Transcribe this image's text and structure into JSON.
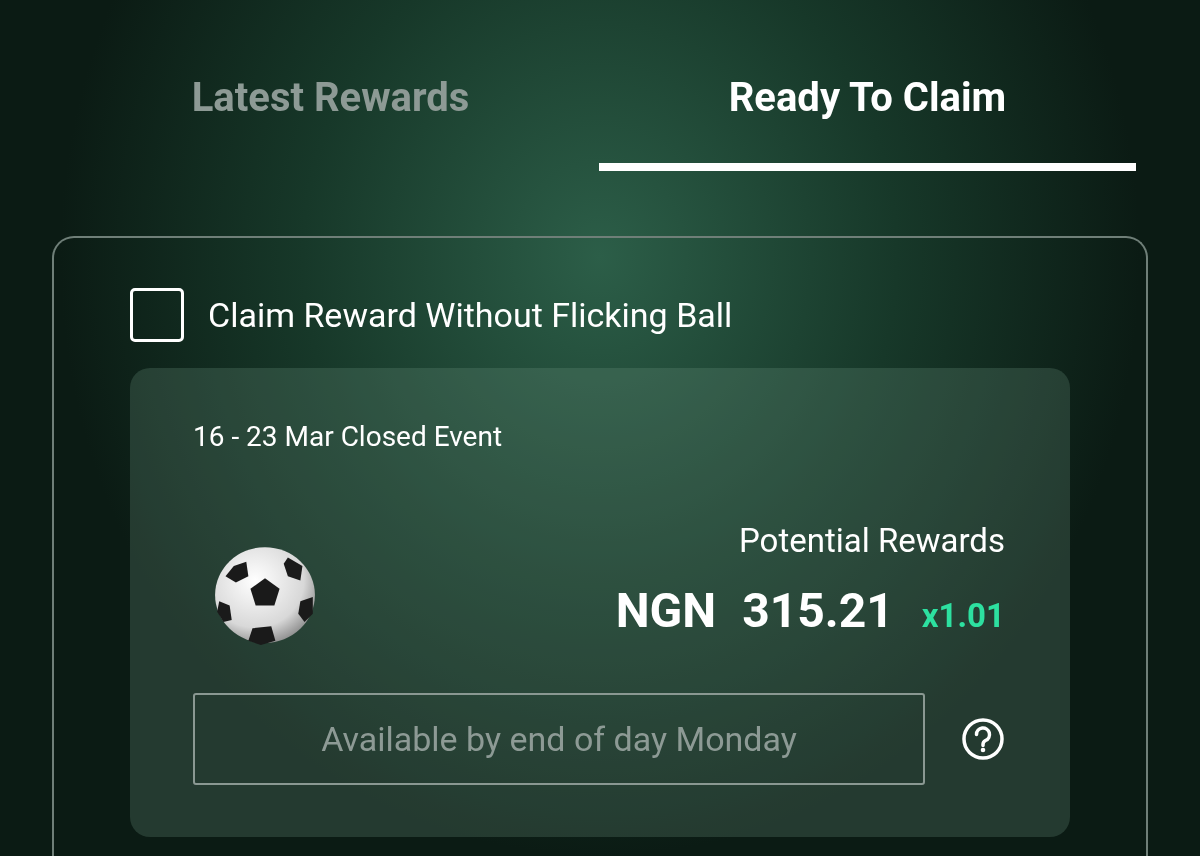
{
  "tabs": [
    {
      "label": "Latest Rewards",
      "selected": false
    },
    {
      "label": "Ready To Claim",
      "selected": true
    }
  ],
  "claim_option": {
    "label": "Claim Reward Without Flicking Ball",
    "checked": false
  },
  "reward_card": {
    "event": "16 - 23 Mar Closed Event",
    "rewards_label": "Potential Rewards",
    "currency": "NGN",
    "amount": "315.21",
    "multiplier": "x1.01",
    "claim_button": {
      "label": "Available by end of day Monday",
      "disabled": true
    }
  }
}
